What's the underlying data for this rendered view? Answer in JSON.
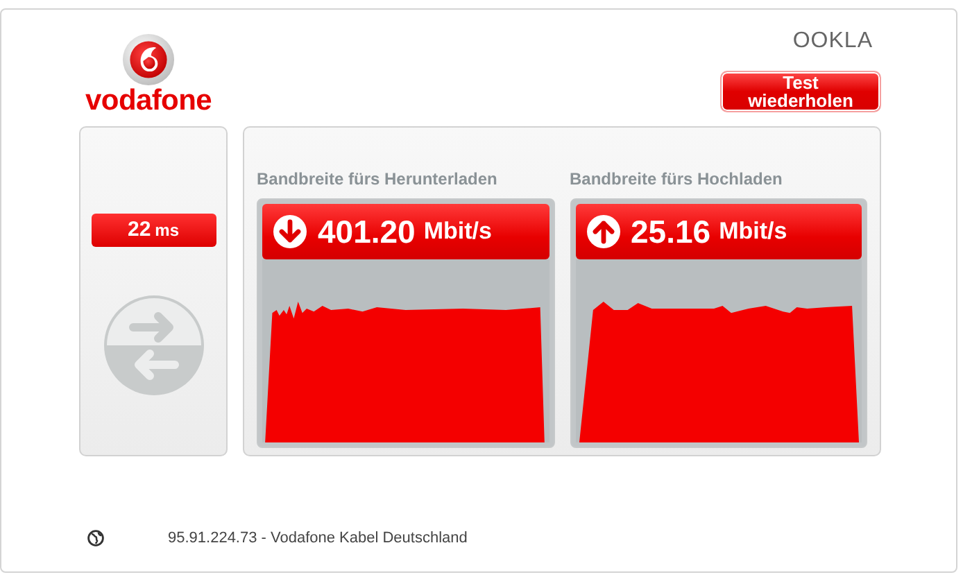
{
  "header": {
    "brand": "vodafone",
    "partner": "OOKLA",
    "button": "Test wiederholen"
  },
  "ping": {
    "value": "22",
    "unit": "ms"
  },
  "tests": [
    {
      "kind": "download",
      "title": "Bandbreite fürs Herunterladen",
      "value": "401.20",
      "unit": "Mbit/s"
    },
    {
      "kind": "upload",
      "title": "Bandbreite fürs Hochladen",
      "value": "25.16",
      "unit": "Mbit/s"
    }
  ],
  "footer": {
    "text": "95.91.224.73 - Vodafone Kabel Deutschland"
  }
}
